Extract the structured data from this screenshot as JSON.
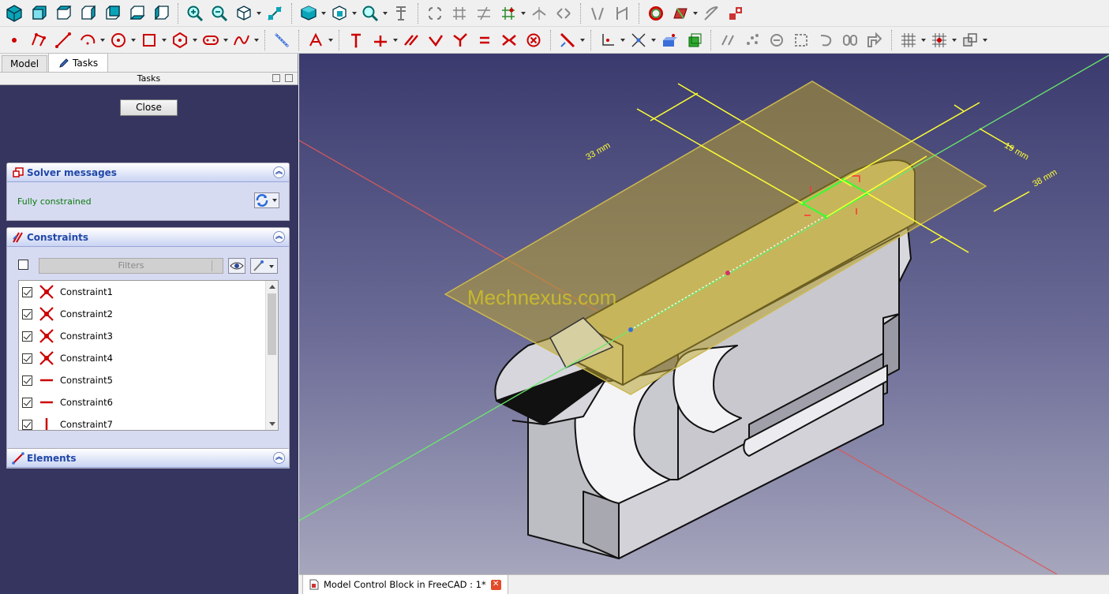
{
  "toolbar_row1": {
    "icons": [
      "view-fit-all-icon",
      "view-front-icon",
      "view-top-icon",
      "view-right-icon",
      "view-rear-icon",
      "view-bottom-icon",
      "view-left-icon",
      "zoom-in-icon",
      "zoom-out-icon",
      "isometric-menu-icon",
      "measure-distance-icon",
      "std-views-box-icon",
      "box-selection-icon",
      "zoom-menu-icon",
      "clipping-icon",
      "sketch-edit-icon",
      "sketch-grid-icon",
      "sketch-fillet-icon",
      "sketch-external-icon",
      "sketch-carbon-copy-icon",
      "sketch-symmetry-icon",
      "sketch-clone-icon",
      "sketch-show-hide-icon",
      "sketch-validate-icon",
      "sketch-map-icon",
      "sketch-reorient-icon"
    ]
  },
  "toolbar_row2": {
    "icons": [
      "point-icon",
      "polyline-icon",
      "line-icon",
      "arc-icon",
      "circle-icon",
      "rectangle-icon",
      "polygon-icon",
      "slot-icon",
      "bspline-icon",
      "construction-toggle-icon",
      "trim-icon",
      "constrain-coincident-icon",
      "constrain-vertical-icon",
      "constrain-horizontal-icon",
      "constrain-parallel-icon",
      "constrain-perpendicular-icon",
      "constrain-tangent-icon",
      "constrain-equal-icon",
      "constrain-symmetric-icon",
      "constrain-block-icon",
      "constrain-lock-icon",
      "constrain-distance-icon",
      "constrain-radius-icon",
      "view-sketch-icon",
      "view-section-icon",
      "select-constraints-icon",
      "select-elements-icon",
      "select-redundant-icon",
      "select-conflicting-icon",
      "select-horizontal-icon",
      "select-vertical-icon",
      "grid-icon",
      "snap-icon",
      "render-order-icon"
    ]
  },
  "tabs": {
    "model": "Model",
    "tasks": "Tasks"
  },
  "panel": {
    "title": "Tasks"
  },
  "close_button": "Close",
  "solver": {
    "title": "Solver messages",
    "message": "Fully constrained"
  },
  "constraints": {
    "title": "Constraints",
    "filter_placeholder": "Filters",
    "items": [
      {
        "label": "Constraint1",
        "type": "coincident",
        "checked": true
      },
      {
        "label": "Constraint2",
        "type": "coincident",
        "checked": true
      },
      {
        "label": "Constraint3",
        "type": "coincident",
        "checked": true
      },
      {
        "label": "Constraint4",
        "type": "coincident",
        "checked": true
      },
      {
        "label": "Constraint5",
        "type": "horizontal",
        "checked": true
      },
      {
        "label": "Constraint6",
        "type": "horizontal",
        "checked": true
      },
      {
        "label": "Constraint7",
        "type": "vertical",
        "checked": true
      }
    ]
  },
  "elements": {
    "title": "Elements"
  },
  "viewport": {
    "watermark": "Mechnexus.com",
    "dimensions": [
      "33 mm",
      "19 mm",
      "38 mm"
    ],
    "colors": {
      "dimension": "#ffff33",
      "sketch_geometry": "#33ff33",
      "x_axis": "#e05555",
      "y_axis": "#66ee66",
      "sketch_plane": "#b8a030"
    }
  },
  "document_tab": {
    "title": "Model Control Block in FreeCAD : 1*"
  }
}
